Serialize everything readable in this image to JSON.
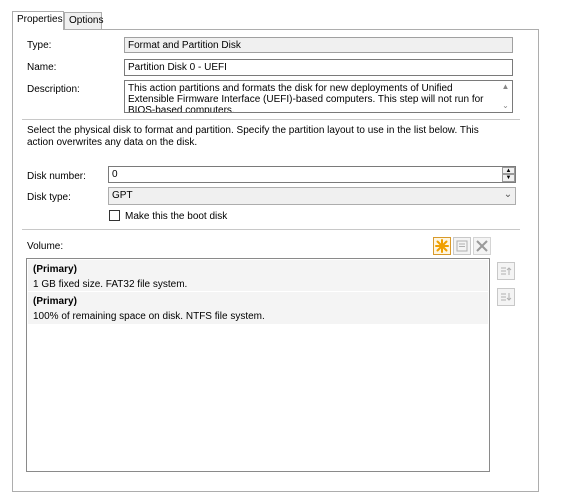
{
  "tabs": [
    {
      "label": "Properties",
      "active": true
    },
    {
      "label": "Options",
      "active": false
    }
  ],
  "form": {
    "type_label": "Type:",
    "type_value": "Format and Partition Disk",
    "name_label": "Name:",
    "name_value": "Partition Disk 0 - UEFI",
    "description_label": "Description:",
    "description_value": "This action partitions and formats the disk for new deployments of Unified Extensible Firmware Interface (UEFI)-based computers. This step will not run for BIOS-based computers."
  },
  "instructions": "Select the physical disk to format and partition. Specify the partition layout to use in the list below. This action overwrites any data on the disk.",
  "disk": {
    "number_label": "Disk number:",
    "number_value": "0",
    "type_label": "Disk type:",
    "type_value": "GPT",
    "boot_checkbox_label": "Make this the boot disk",
    "boot_checked": false
  },
  "volume": {
    "label": "Volume:",
    "items": [
      {
        "title": "(Primary)",
        "detail": "1 GB fixed size. FAT32 file system."
      },
      {
        "title": "(Primary)",
        "detail": "100% of remaining space on disk. NTFS file system."
      }
    ]
  },
  "icons": [
    "new-volume-icon",
    "properties-icon",
    "delete-icon",
    "move-up-icon",
    "move-down-icon"
  ],
  "colors": {
    "accent": "#f0a000",
    "border": "#adadad",
    "disabled_icon": "#b0b0b0"
  }
}
